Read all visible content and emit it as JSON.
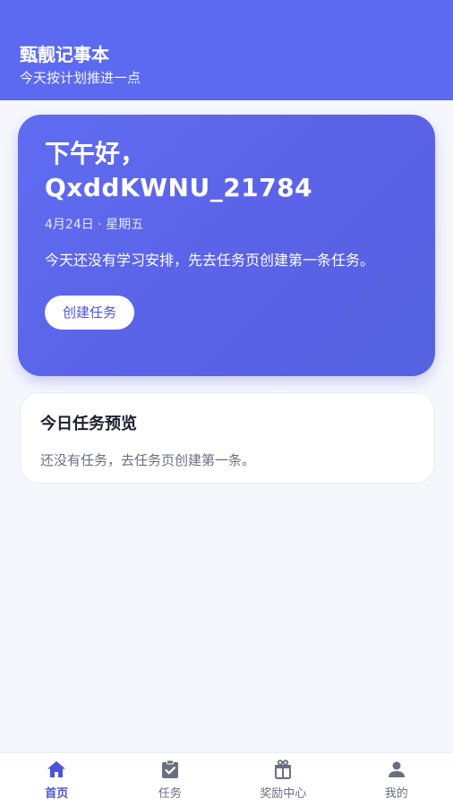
{
  "header": {
    "title": "甄靓记事本",
    "subtitle": "今天按计划推进一点"
  },
  "hero": {
    "greeting": "下午好，",
    "username": "QxddKWNU_21784",
    "date": "4月24日 · 星期五",
    "message": "今天还没有学习安排，先去任务页创建第一条任务。",
    "cta_label": "创建任务"
  },
  "preview": {
    "title": "今日任务预览",
    "empty_text": "还没有任务，去任务页创建第一条。"
  },
  "tabbar": {
    "items": [
      {
        "label": "首页",
        "icon": "home-icon",
        "active": true
      },
      {
        "label": "任务",
        "icon": "clipboard-check-icon",
        "active": false
      },
      {
        "label": "奖励中心",
        "icon": "gift-icon",
        "active": false
      },
      {
        "label": "我的",
        "icon": "person-icon",
        "active": false
      }
    ]
  },
  "colors": {
    "primary": "#5b6af0",
    "accent_text": "#4a55d8"
  }
}
